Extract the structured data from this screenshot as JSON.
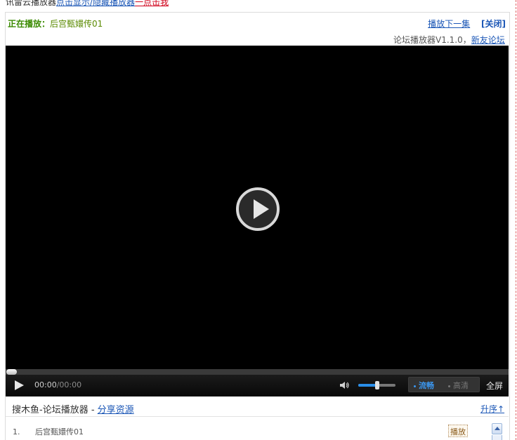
{
  "top": {
    "prefix": "讯雷云播放器",
    "link_show": "点击显示/隐藏播放器",
    "link_red": "一点击我"
  },
  "player": {
    "now_playing_label": "正在播放：",
    "now_playing_title": "后宫甄嬛传01",
    "next_label": "播放下一集",
    "close_label": "[关闭]",
    "version_text": "论坛播放器V1.1.0，",
    "version_link": "新友论坛"
  },
  "controls": {
    "time_current": "00:00",
    "time_sep": "/",
    "time_total": "00:00",
    "volume_level": 0.5,
    "quality_options": [
      "流畅",
      "高清"
    ],
    "quality_selected": "流畅",
    "fullscreen_label": "全屏",
    "progress": 0
  },
  "playlist": {
    "header_prefix": "搜木鱼-论坛播放器 - ",
    "share_label": "分享资源",
    "sort_label": "升序↑",
    "items": [
      {
        "index": "1.",
        "title": "后宫甄嬛传01",
        "action": "播放"
      }
    ]
  },
  "colors": {
    "accent_blue": "#2a8ee8",
    "link_blue": "#1a56b6",
    "now_playing_green": "#3a8a00",
    "link_red": "#d0021b"
  }
}
